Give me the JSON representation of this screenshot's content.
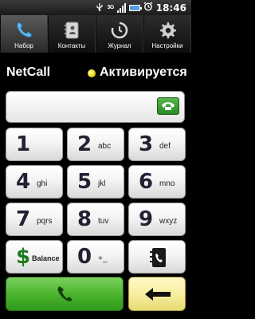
{
  "status_bar": {
    "network": "3G",
    "time": "18:46"
  },
  "tabs": [
    {
      "label": "Набор",
      "icon": "phone-icon",
      "active": true
    },
    {
      "label": "Контакты",
      "icon": "contacts-book-icon",
      "active": false
    },
    {
      "label": "Журнал",
      "icon": "clock-icon",
      "active": false
    },
    {
      "label": "Настройки",
      "icon": "gear-icon",
      "active": false
    }
  ],
  "header": {
    "app_name": "NetCall",
    "status": "Активируется",
    "status_color": "#e7d000"
  },
  "number_input": {
    "value": ""
  },
  "keys": [
    {
      "digit": "1",
      "letters": ""
    },
    {
      "digit": "2",
      "letters": "abc"
    },
    {
      "digit": "3",
      "letters": "def"
    },
    {
      "digit": "4",
      "letters": "ghi"
    },
    {
      "digit": "5",
      "letters": "jkl"
    },
    {
      "digit": "6",
      "letters": "mno"
    },
    {
      "digit": "7",
      "letters": "pqrs"
    },
    {
      "digit": "8",
      "letters": "tuv"
    },
    {
      "digit": "9",
      "letters": "wxyz"
    },
    {
      "digit": "$",
      "letters": "Balance"
    },
    {
      "digit": "0",
      "letters": "+_"
    },
    {
      "digit": "",
      "letters": "",
      "icon": "contacts-icon"
    }
  ],
  "colors": {
    "call_green": "#4cb52f",
    "back_yellow": "#f7eea0"
  }
}
